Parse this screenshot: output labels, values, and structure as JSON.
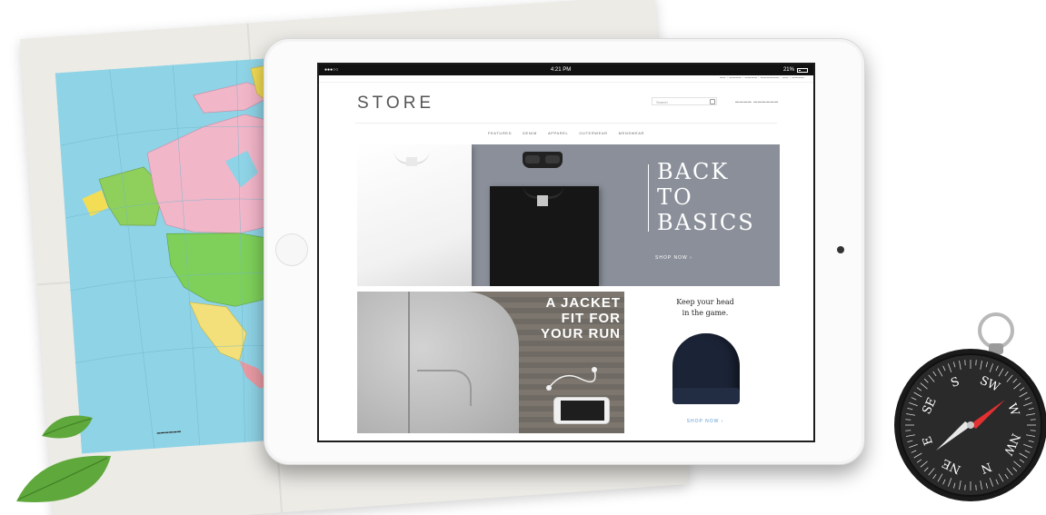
{
  "status_bar": {
    "carrier": "●●●○○ ",
    "time": "4:21 PM",
    "battery": "21%"
  },
  "store": {
    "logo": "STORE",
    "search_placeholder": "Search",
    "nav_items": [
      "FEATURED",
      "DENIM",
      "APPAREL",
      "OUTERWEAR",
      "MENSWEAR"
    ]
  },
  "hero": {
    "title_lines": [
      "BACK",
      "TO",
      "BASICS"
    ],
    "cta": "SHOP NOW ›"
  },
  "jacket_promo": {
    "title_lines": [
      "A JACKET",
      "FIT FOR",
      "YOUR RUN"
    ]
  },
  "beanie_promo": {
    "title_lines": [
      "Keep your head",
      "in the game."
    ],
    "cta": "SHOP NOW ›"
  },
  "compass": {
    "labels": [
      "N",
      "NE",
      "E",
      "SE",
      "S",
      "SW",
      "W",
      "NW"
    ]
  },
  "colors": {
    "hero_bg": "#8a8f99",
    "map_water": "#8ed3e6",
    "canada": "#f2b6c9",
    "usa": "#7ed05a",
    "alaska": "#8fcf5b",
    "greenland": "#f3dd55",
    "leaf": "#5fa83b",
    "link_blue": "#5a9bd5"
  }
}
